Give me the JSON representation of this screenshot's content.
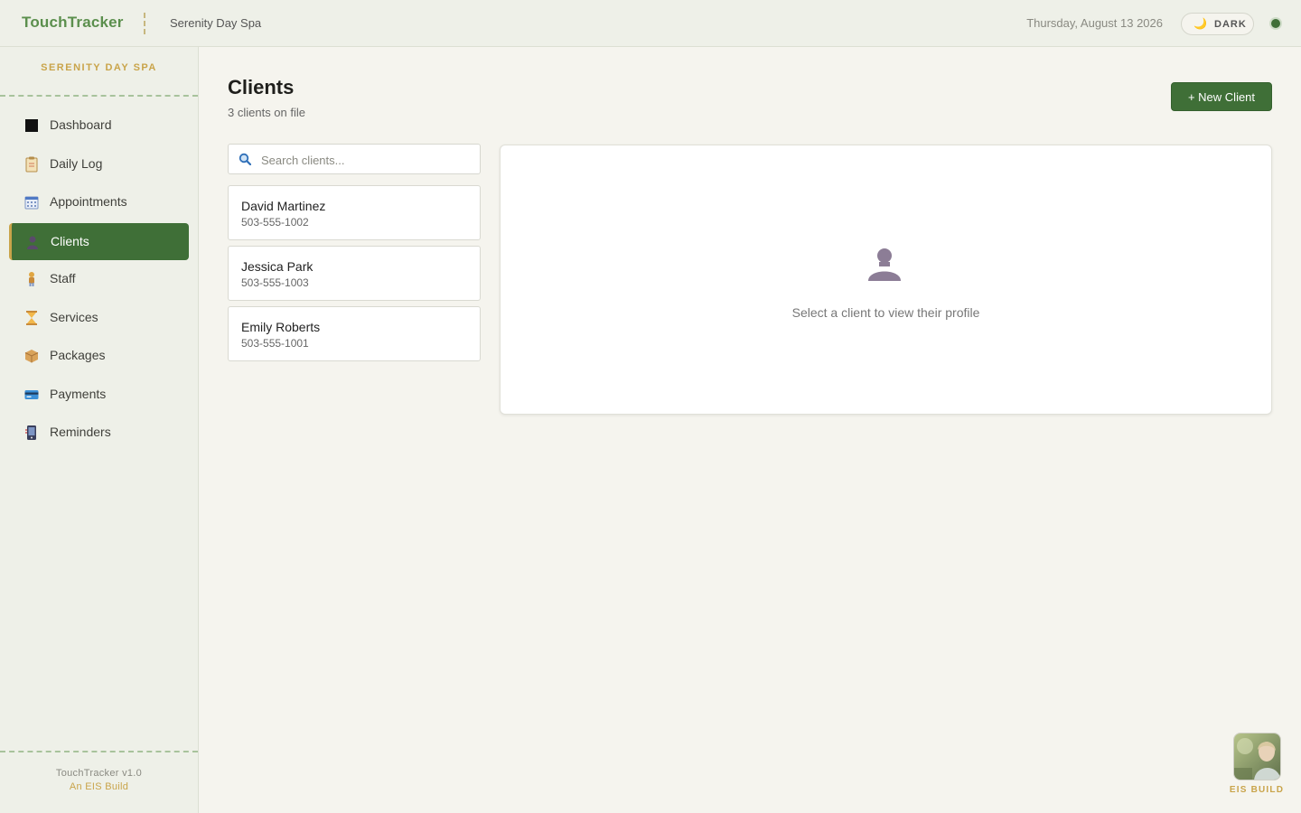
{
  "header": {
    "brand": "TouchTracker",
    "spa_name": "Serenity Day Spa",
    "date": "Thursday, August 13 2026",
    "dark_toggle_label": "DARK",
    "dark_toggle_icon": "moon-icon",
    "status_color": "#3f6f37"
  },
  "sidebar": {
    "title": "SERENITY DAY SPA",
    "items": [
      {
        "label": "Dashboard",
        "icon": "square-icon",
        "active": false
      },
      {
        "label": "Daily Log",
        "icon": "clipboard-icon",
        "active": false
      },
      {
        "label": "Appointments",
        "icon": "calendar-icon",
        "active": false
      },
      {
        "label": "Clients",
        "icon": "person-icon",
        "active": true
      },
      {
        "label": "Staff",
        "icon": "staff-icon",
        "active": false
      },
      {
        "label": "Services",
        "icon": "hourglass-icon",
        "active": false
      },
      {
        "label": "Packages",
        "icon": "package-icon",
        "active": false
      },
      {
        "label": "Payments",
        "icon": "credit-card-icon",
        "active": false
      },
      {
        "label": "Reminders",
        "icon": "phone-icon",
        "active": false
      }
    ],
    "version": "TouchTracker v1.0",
    "build": "An EIS Build"
  },
  "main": {
    "title": "Clients",
    "subtitle": "3 clients on file",
    "new_button": "+ New Client",
    "search_placeholder": "Search clients...",
    "clients": [
      {
        "name": "David Martinez",
        "phone": "503-555-1002"
      },
      {
        "name": "Jessica Park",
        "phone": "503-555-1003"
      },
      {
        "name": "Emily Roberts",
        "phone": "503-555-1001"
      }
    ],
    "empty_state": "Select a client to view their profile"
  },
  "badge": {
    "label": "EIS BUILD"
  },
  "colors": {
    "accent": "#3f6f37",
    "brand": "#5b8f4d",
    "gold": "#c9a44a",
    "background": "#f5f4ee"
  }
}
